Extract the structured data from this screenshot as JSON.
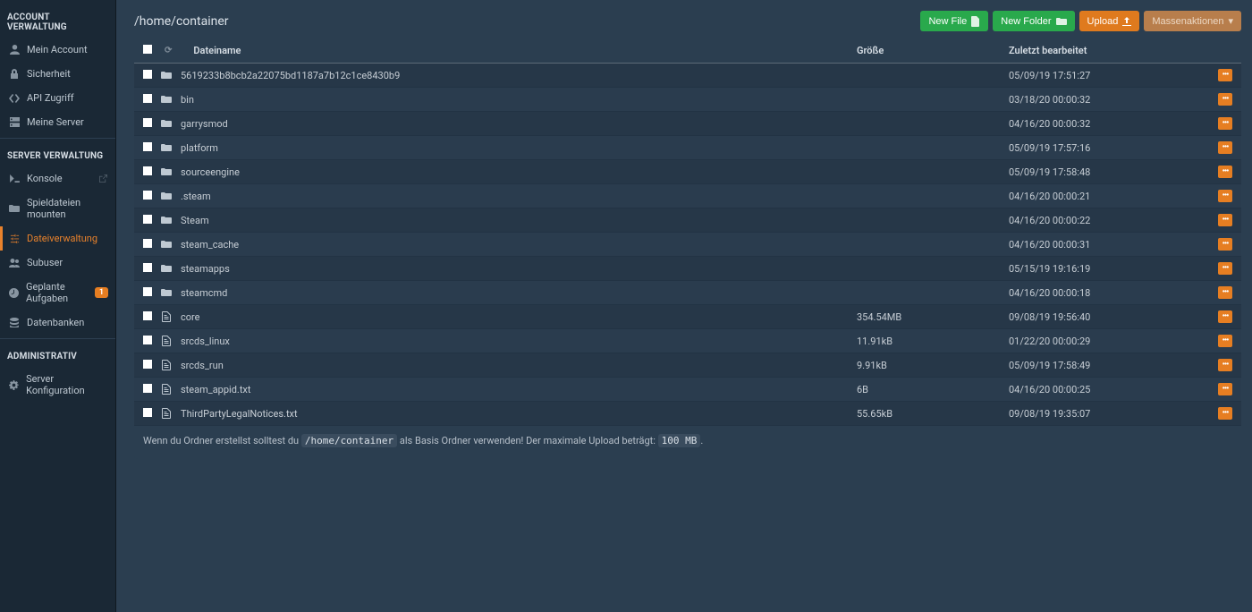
{
  "sidebar": {
    "sections": [
      {
        "title": "ACCOUNT VERWALTUNG",
        "items": [
          {
            "label": "Mein Account",
            "icon": "user-icon"
          },
          {
            "label": "Sicherheit",
            "icon": "lock-icon"
          },
          {
            "label": "API Zugriff",
            "icon": "code-icon"
          },
          {
            "label": "Meine Server",
            "icon": "server-icon"
          }
        ]
      },
      {
        "title": "SERVER VERWALTUNG",
        "items": [
          {
            "label": "Konsole",
            "icon": "terminal-icon",
            "external": true
          },
          {
            "label": "Spieldateien mounten",
            "icon": "folder-open-icon"
          },
          {
            "label": "Dateiverwaltung",
            "icon": "sliders-icon",
            "active": true
          },
          {
            "label": "Subuser",
            "icon": "users-icon"
          },
          {
            "label": "Geplante Aufgaben",
            "icon": "clock-icon",
            "badge": "1"
          },
          {
            "label": "Datenbanken",
            "icon": "database-icon"
          }
        ]
      },
      {
        "title": "ADMINISTRATIV",
        "items": [
          {
            "label": "Server Konfiguration",
            "icon": "gear-icon"
          }
        ]
      }
    ]
  },
  "breadcrumb": "/home/container",
  "buttons": {
    "new_file": "New File",
    "new_folder": "New Folder",
    "upload": "Upload",
    "mass": "Massenaktionen"
  },
  "headers": {
    "name": "Dateiname",
    "size": "Größe",
    "date": "Zuletzt bearbeitet"
  },
  "rows": [
    {
      "type": "folder",
      "name": "5619233b8bcb2a22075bd1187a7b12c1ce8430b9",
      "size": "",
      "date": "05/09/19 17:51:27"
    },
    {
      "type": "folder",
      "name": "bin",
      "size": "",
      "date": "03/18/20 00:00:32"
    },
    {
      "type": "folder",
      "name": "garrysmod",
      "size": "",
      "date": "04/16/20 00:00:32"
    },
    {
      "type": "folder",
      "name": "platform",
      "size": "",
      "date": "05/09/19 17:57:16"
    },
    {
      "type": "folder",
      "name": "sourceengine",
      "size": "",
      "date": "05/09/19 17:58:48"
    },
    {
      "type": "folder",
      "name": ".steam",
      "size": "",
      "date": "04/16/20 00:00:21"
    },
    {
      "type": "folder",
      "name": "Steam",
      "size": "",
      "date": "04/16/20 00:00:22"
    },
    {
      "type": "folder",
      "name": "steam_cache",
      "size": "",
      "date": "04/16/20 00:00:31"
    },
    {
      "type": "folder",
      "name": "steamapps",
      "size": "",
      "date": "05/15/19 19:16:19"
    },
    {
      "type": "folder",
      "name": "steamcmd",
      "size": "",
      "date": "04/16/20 00:00:18"
    },
    {
      "type": "file",
      "name": "core",
      "size": "354.54MB",
      "date": "09/08/19 19:56:40"
    },
    {
      "type": "file",
      "name": "srcds_linux",
      "size": "11.91kB",
      "date": "01/22/20 00:00:29"
    },
    {
      "type": "file",
      "name": "srcds_run",
      "size": "9.91kB",
      "date": "05/09/19 17:58:49"
    },
    {
      "type": "file",
      "name": "steam_appid.txt",
      "size": "6B",
      "date": "04/16/20 00:00:25"
    },
    {
      "type": "file",
      "name": "ThirdPartyLegalNotices.txt",
      "size": "55.65kB",
      "date": "09/08/19 19:35:07"
    }
  ],
  "footer": {
    "part1": "Wenn du Ordner erstellst solltest du ",
    "code1": "/home/container",
    "part2": " als Basis Ordner verwenden! Der maximale Upload beträgt: ",
    "code2": "100 MB",
    "part3": "."
  }
}
